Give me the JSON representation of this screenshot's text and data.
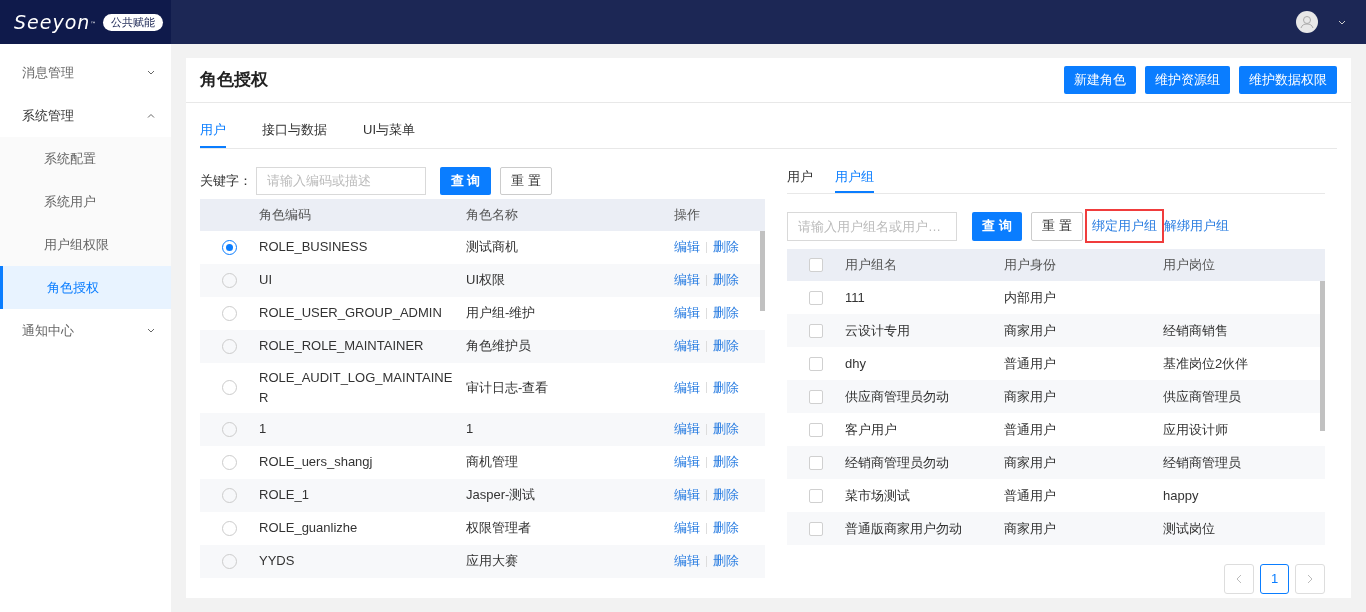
{
  "header": {
    "logo": "Seeyon",
    "logo_mark": "™",
    "badge": "公共赋能"
  },
  "sidebar": {
    "items": [
      {
        "label": "消息管理",
        "expanded": false,
        "selected": false
      },
      {
        "label": "系统管理",
        "expanded": true,
        "selected": false,
        "children": [
          {
            "label": "系统配置",
            "selected": false
          },
          {
            "label": "系统用户",
            "selected": false
          },
          {
            "label": "用户组权限",
            "selected": false
          },
          {
            "label": "角色授权",
            "selected": true
          }
        ]
      },
      {
        "label": "通知中心",
        "expanded": false,
        "selected": false
      }
    ]
  },
  "page": {
    "title": "角色授权",
    "actions": [
      "新建角色",
      "维护资源组",
      "维护数据权限"
    ],
    "tabs": [
      {
        "label": "用户",
        "selected": true
      },
      {
        "label": "接口与数据",
        "selected": false
      },
      {
        "label": "UI与菜单",
        "selected": false
      }
    ]
  },
  "roles": {
    "keyword_label": "关键字：",
    "search": {
      "placeholder": "请输入编码或描述"
    },
    "query": "查 询",
    "reset": "重 置",
    "columns": [
      "角色编码",
      "角色名称",
      "操作"
    ],
    "rows": [
      {
        "code": "ROLE_BUSINESS",
        "name": "测试商机",
        "selected": true,
        "edit": "编辑",
        "delete": "删除"
      },
      {
        "code": "UI",
        "name": "UI权限",
        "selected": false,
        "edit": "编辑",
        "delete": "删除"
      },
      {
        "code": "ROLE_USER_GROUP_ADMIN",
        "name": "用户组-维护",
        "selected": false,
        "edit": "编辑",
        "delete": "删除"
      },
      {
        "code": "ROLE_ROLE_MAINTAINER",
        "name": "角色维护员",
        "selected": false,
        "edit": "编辑",
        "delete": "删除"
      },
      {
        "code": "ROLE_AUDIT_LOG_MAINTAINER",
        "name": "审计日志-查看",
        "selected": false,
        "edit": "编辑",
        "delete": "删除"
      },
      {
        "code": "1",
        "name": "1",
        "selected": false,
        "edit": "编辑",
        "delete": "删除"
      },
      {
        "code": "ROLE_uers_shangj",
        "name": "商机管理",
        "selected": false,
        "edit": "编辑",
        "delete": "删除"
      },
      {
        "code": "ROLE_1",
        "name": "Jasper-测试",
        "selected": false,
        "edit": "编辑",
        "delete": "删除"
      },
      {
        "code": "ROLE_guanlizhe",
        "name": "权限管理者",
        "selected": false,
        "edit": "编辑",
        "delete": "删除"
      },
      {
        "code": "YYDS",
        "name": "应用大赛",
        "selected": false,
        "edit": "编辑",
        "delete": "删除"
      }
    ]
  },
  "groups": {
    "tabs": [
      {
        "label": "用户",
        "selected": false
      },
      {
        "label": "用户组",
        "selected": true
      }
    ],
    "search": {
      "placeholder": "请输入用户组名或用户…"
    },
    "query": "查 询",
    "reset": "重 置",
    "links": [
      {
        "label": "绑定用户组",
        "highlighted": true
      },
      {
        "label": "解绑用户组",
        "highlighted": false
      }
    ],
    "columns": [
      "用户组名",
      "用户身份",
      "用户岗位"
    ],
    "all_checked": false,
    "rows": [
      {
        "name": "111",
        "identity": "内部用户",
        "checked": false
      },
      {
        "name": "云设计专用",
        "identity": "商家用户",
        "post": "经销商销售",
        "checked": false
      },
      {
        "name": "dhy",
        "identity": "普通用户",
        "post": "基准岗位2伙伴",
        "checked": false
      },
      {
        "name": "供应商管理员勿动",
        "identity": "商家用户",
        "post": "供应商管理员",
        "checked": false
      },
      {
        "name": "客户用户",
        "identity": "普通用户",
        "post": "应用设计师",
        "checked": false
      },
      {
        "name": "经销商管理员勿动",
        "identity": "商家用户",
        "post": "经销商管理员",
        "checked": false
      },
      {
        "name": "菜市场测试",
        "identity": "普通用户",
        "post": "happy",
        "checked": false
      },
      {
        "name": "普通版商家用户勿动",
        "identity": "商家用户",
        "post": "测试岗位",
        "checked": false
      }
    ],
    "pagination": {
      "pages": [
        {
          "label": "1",
          "selected": true
        }
      ]
    }
  }
}
